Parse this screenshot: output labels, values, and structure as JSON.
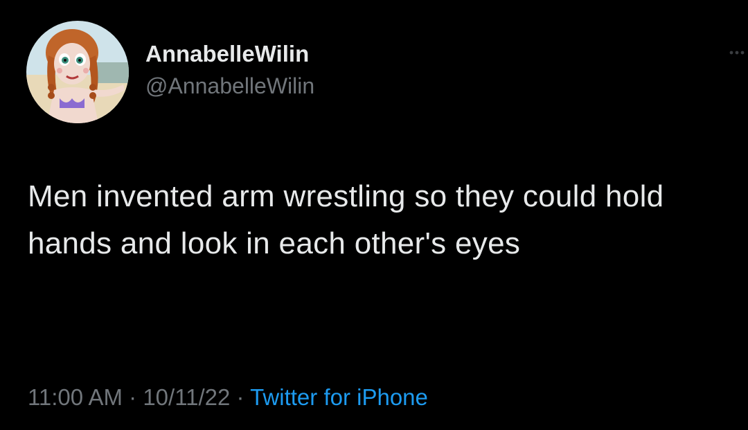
{
  "author": {
    "display_name": "AnnabelleWilin",
    "handle": "@AnnabelleWilin",
    "avatar_icon": "doll-avatar"
  },
  "tweet": {
    "text": "Men invented arm wrestling so they could hold hands and look in each other's eyes",
    "time": "11:00 AM",
    "separator": "·",
    "date": "10/11/22",
    "source": "Twitter for iPhone"
  },
  "menu": {
    "icon": "more-icon"
  },
  "colors": {
    "background": "#000000",
    "text": "#e7e9ea",
    "secondary": "#71767b",
    "link": "#1d9bf0"
  }
}
